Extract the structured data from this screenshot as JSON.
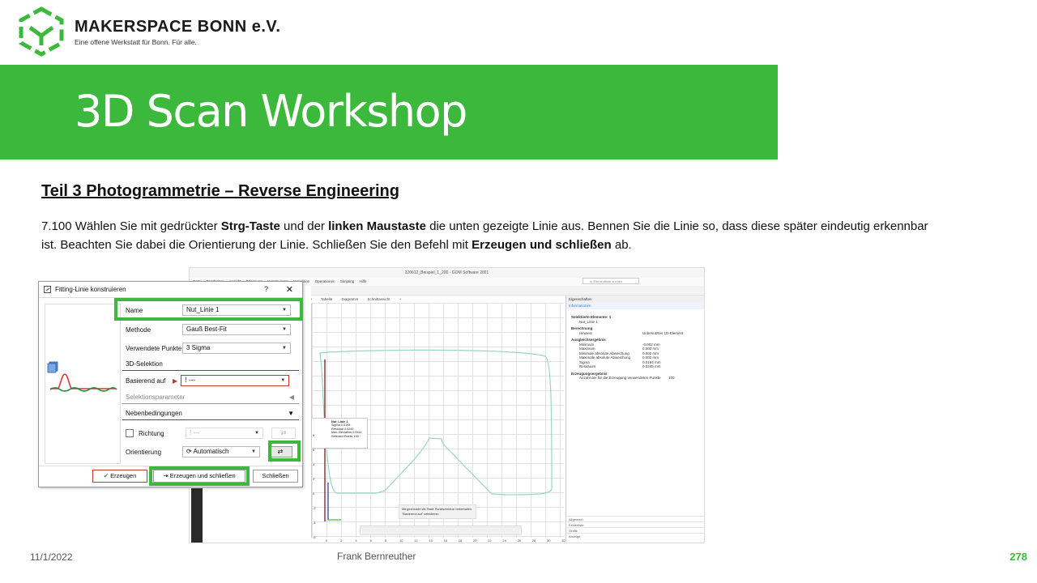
{
  "header": {
    "brand_name": "MAKERSPACE BONN e.V.",
    "brand_tagline": "Eine offene Werkstatt für Bonn. Für alle.",
    "title": "3D Scan Workshop"
  },
  "section_title": "Teil 3  Photogrammetrie  – Reverse Engineering",
  "instruction": {
    "p1": "7.100 Wählen Sie mit gedrückter ",
    "b1": "Strg-Taste",
    "p2": " und der ",
    "b2": "linken Maustaste",
    "p3": " die unten gezeigte Linie aus. Bennen Sie die Linie so, dass diese später eindeutig erkennbar ist. Beachten Sie dabei die Orientierung der Linie. Schließen Sie den Befehl mit ",
    "b3": "Erzeugen und schließen",
    "p4": " ab."
  },
  "app": {
    "window_title": "220612_Beispiel_1_200 - GOM Software 2021",
    "menu": [
      "Datei",
      "Bearbeiten",
      "Ansicht",
      "Erfassung",
      "Konstruieren",
      "Inspektion",
      "Operationen",
      "Skripting",
      "Hilfe"
    ],
    "search_placeholder": "In Elementliste suchen",
    "tabs": [
      "3D",
      "Tabelle",
      "Diagramm",
      "Schnittansicht",
      "+"
    ],
    "properties": {
      "tab": "Eigenschaften",
      "sub": "Informationen",
      "selected_header": "Selektierte Elemente: 1",
      "selected_item": "Nut_Linie 1",
      "calc_header": "Berechnung",
      "hint_label": "Hinweis",
      "hint_value": "Unbenutztes 1D-Element",
      "fit_header": "Ausgleichsergebnis",
      "fit_rows": [
        {
          "k": "Minimum",
          "v": "-0.002 mm"
        },
        {
          "k": "Maximum",
          "v": "0.002 mm"
        },
        {
          "k": "Minimale absolute Abweichung",
          "v": "0.002 mm"
        },
        {
          "k": "Maximale absolute Abweichung",
          "v": "0.002 mm"
        },
        {
          "k": "Sigma",
          "v": "0.0194 mm"
        },
        {
          "k": "Residuum",
          "v": "0.0245 mm"
        }
      ],
      "gen_header": "Erzeugungsergebnis",
      "gen_row_k": "Anzahl der für die Erzeugung verwendeten Punkte",
      "gen_row_v": "100",
      "bottom": [
        "Allgemein",
        "Fehlerliste",
        "Grafik",
        "Anzeige"
      ]
    },
    "infobox": {
      "title": "Nut_Linie 1",
      "rows": [
        {
          "k": "Sigma",
          "v": "0.0194"
        },
        {
          "k": "Residual",
          "v": "0.0245"
        },
        {
          "k": "Max. Deviation",
          "v": "0.0411"
        },
        {
          "k": "Selected Points",
          "v": "100"
        }
      ]
    },
    "hint_text_1": "Mit gedrückter Alt-Taste Punktselektion beibehalten.",
    "hint_text_2": "\"Basierend auf\" selektieren",
    "x_ticks": [
      "0",
      "2",
      "4",
      "6",
      "8",
      "10",
      "12",
      "14",
      "16",
      "18",
      "20",
      "22",
      "24",
      "26",
      "28",
      "30",
      "32"
    ],
    "y_ticks": [
      "8",
      "6",
      "4",
      "2",
      "0",
      "-2",
      "-4",
      "-6"
    ]
  },
  "dialog": {
    "title": "Fitting-Linie konstruieren",
    "help": "?",
    "close": "✕",
    "name_label": "Name",
    "name_value": "Nut_Linie 1",
    "method_label": "Methode",
    "method_value": "Gauß Best-Fit",
    "points_label": "Verwendete Punkte",
    "points_value": "3 Sigma",
    "section_3d": "3D-Selektion",
    "based_label": "Basierend auf",
    "based_value": "---",
    "section_sel": "Selektionsparameter",
    "section_neben": "Nebenbedingungen",
    "direction_label": "Richtung",
    "direction_value": "---",
    "orient_label": "Orientierung",
    "orient_value": "Automatisch",
    "btn_create": "Erzeugen",
    "btn_create_close": "Erzeugen und schließen",
    "btn_close": "Schließen"
  },
  "footer": {
    "date": "11/1/2022",
    "author": "Frank Bernreuther",
    "page": "278"
  },
  "colors": {
    "brand_green": "#3cb93c"
  }
}
